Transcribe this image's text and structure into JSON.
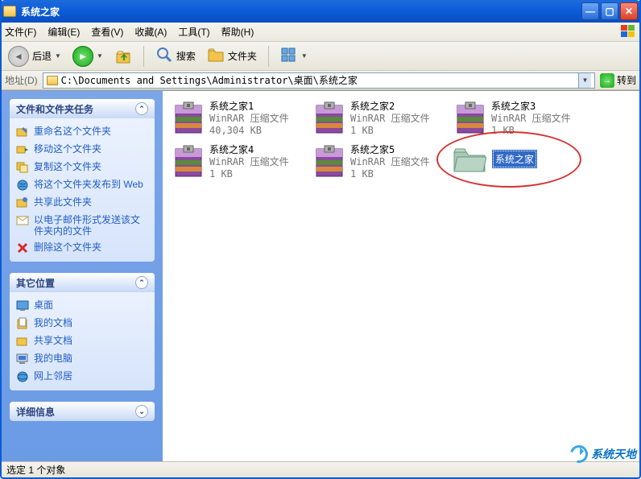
{
  "window": {
    "title": "系统之家"
  },
  "menu": {
    "file": "文件(F)",
    "edit": "编辑(E)",
    "view": "查看(V)",
    "favorites": "收藏(A)",
    "tools": "工具(T)",
    "help": "帮助(H)"
  },
  "toolbar": {
    "back": "后退",
    "search": "搜索",
    "folders": "文件夹"
  },
  "address": {
    "label": "地址(D)",
    "path": "C:\\Documents and Settings\\Administrator\\桌面\\系统之家",
    "go": "转到"
  },
  "sidebar": {
    "tasks": {
      "title": "文件和文件夹任务",
      "items": [
        "重命名这个文件夹",
        "移动这个文件夹",
        "复制这个文件夹",
        "将这个文件夹发布到 Web",
        "共享此文件夹",
        "以电子邮件形式发送该文件夹内的文件",
        "删除这个文件夹"
      ]
    },
    "places": {
      "title": "其它位置",
      "items": [
        "桌面",
        "我的文档",
        "共享文档",
        "我的电脑",
        "网上邻居"
      ]
    },
    "details": {
      "title": "详细信息"
    }
  },
  "files": [
    {
      "name": "系统之家1",
      "type": "WinRAR 压缩文件",
      "size": "40,304 KB"
    },
    {
      "name": "系统之家2",
      "type": "WinRAR 压缩文件",
      "size": "1 KB"
    },
    {
      "name": "系统之家3",
      "type": "WinRAR 压缩文件",
      "size": "1 KB"
    },
    {
      "name": "系统之家4",
      "type": "WinRAR 压缩文件",
      "size": "1 KB"
    },
    {
      "name": "系统之家5",
      "type": "WinRAR 压缩文件",
      "size": "1 KB"
    }
  ],
  "new_folder": {
    "label": "系统之家"
  },
  "status": {
    "text": "选定 1 个对象"
  },
  "watermark": {
    "text": "系统天地"
  }
}
